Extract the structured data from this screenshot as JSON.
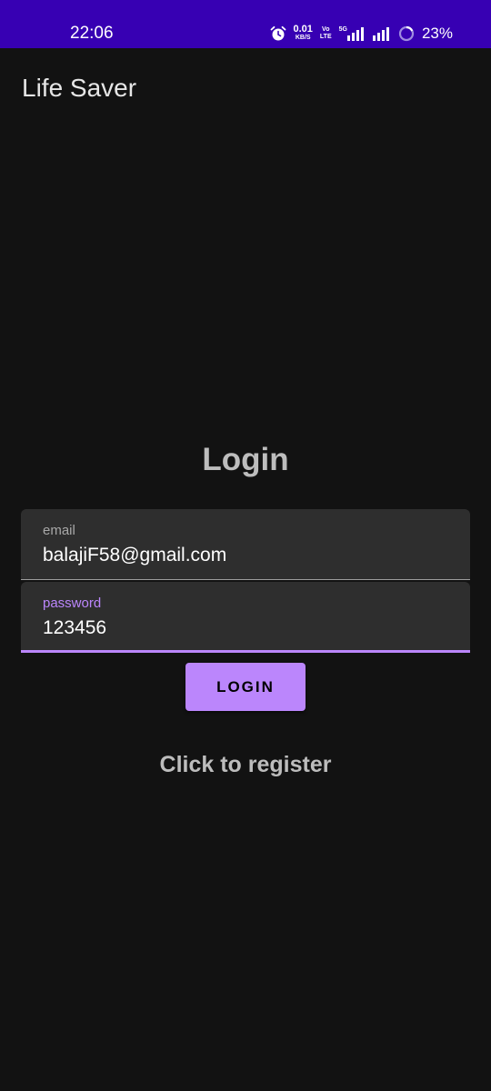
{
  "status_bar": {
    "time": "22:06",
    "net_speed_value": "0.01",
    "net_speed_unit": "KB/S",
    "volte_top": "Vo",
    "volte_bottom": "LTE",
    "network_label": "5G",
    "battery": "23%",
    "background_color": "#3700b3",
    "icons": [
      "alarm-icon",
      "signal-icon",
      "signal-icon",
      "battery-ring-icon"
    ]
  },
  "app_bar": {
    "title": "Life Saver"
  },
  "login": {
    "heading": "Login",
    "email": {
      "label": "email",
      "value": "balajiF58@gmail.com"
    },
    "password": {
      "label": "password",
      "value": "123456"
    },
    "button_label": "LOGIN",
    "register_label": "Click to register",
    "accent_color": "#bb86fc"
  }
}
